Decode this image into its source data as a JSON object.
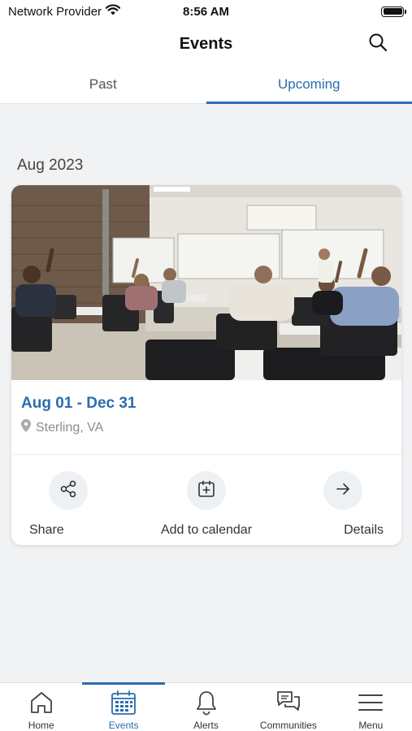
{
  "status_bar": {
    "carrier": "Network Provider",
    "time": "8:56 AM"
  },
  "header": {
    "title": "Events"
  },
  "tabs": [
    {
      "label": "Past",
      "active": false
    },
    {
      "label": "Upcoming",
      "active": true
    }
  ],
  "section": {
    "month": "Aug 2023"
  },
  "event_card": {
    "dates": "Aug 01 - Dec 31",
    "location": "Sterling, VA",
    "actions": {
      "share_label": "Share",
      "calendar_label": "Add to calendar",
      "details_label": "Details"
    }
  },
  "bottom_nav": {
    "items": [
      {
        "label": "Home",
        "icon": "home-icon",
        "active": false
      },
      {
        "label": "Events",
        "icon": "calendar-icon",
        "active": true
      },
      {
        "label": "Alerts",
        "icon": "bell-icon",
        "active": false
      },
      {
        "label": "Communities",
        "icon": "chat-icon",
        "active": false
      },
      {
        "label": "Menu",
        "icon": "hamburger-icon",
        "active": false
      }
    ]
  },
  "colors": {
    "accent": "#2a6db0",
    "background": "#f1f2f4"
  }
}
